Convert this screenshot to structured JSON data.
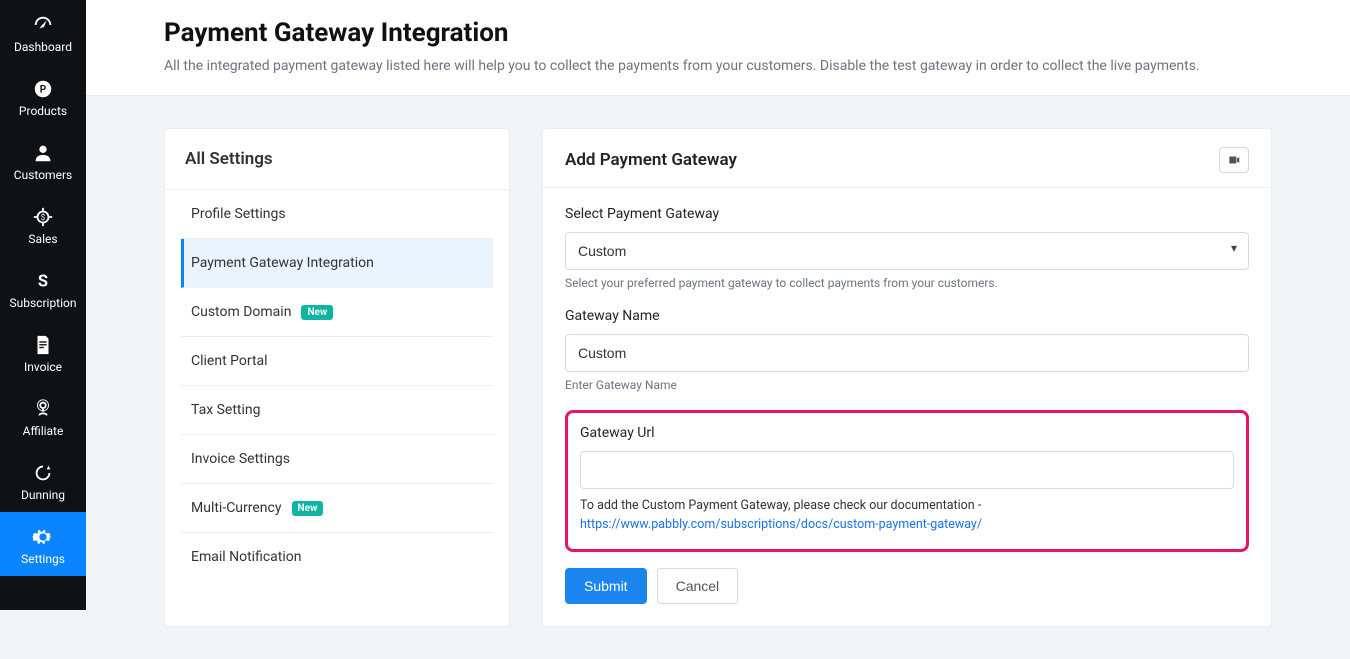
{
  "sidebar": {
    "items": [
      {
        "label": "Dashboard",
        "icon": "dashboard-icon"
      },
      {
        "label": "Products",
        "icon": "products-icon"
      },
      {
        "label": "Customers",
        "icon": "customers-icon"
      },
      {
        "label": "Sales",
        "icon": "sales-icon"
      },
      {
        "label": "Subscription",
        "icon": "subscription-icon"
      },
      {
        "label": "Invoice",
        "icon": "invoice-icon"
      },
      {
        "label": "Affiliate",
        "icon": "affiliate-icon"
      },
      {
        "label": "Dunning",
        "icon": "dunning-icon"
      },
      {
        "label": "Settings",
        "icon": "settings-icon"
      }
    ]
  },
  "header": {
    "title": "Payment Gateway Integration",
    "subtitle": "All the integrated payment gateway listed here will help you to collect the payments from your customers. Disable the test gateway in order to collect the live payments."
  },
  "settings_panel": {
    "title": "All Settings",
    "items": [
      {
        "label": "Profile Settings",
        "badge": null,
        "active": false
      },
      {
        "label": "Payment Gateway Integration",
        "badge": null,
        "active": true
      },
      {
        "label": "Custom Domain",
        "badge": "New",
        "active": false
      },
      {
        "label": "Client Portal",
        "badge": null,
        "active": false
      },
      {
        "label": "Tax Setting",
        "badge": null,
        "active": false
      },
      {
        "label": "Invoice Settings",
        "badge": null,
        "active": false
      },
      {
        "label": "Multi-Currency",
        "badge": "New",
        "active": false
      },
      {
        "label": "Email Notification",
        "badge": null,
        "active": false
      }
    ]
  },
  "form": {
    "title": "Add Payment Gateway",
    "select_label": "Select Payment Gateway",
    "select_value": "Custom",
    "select_helper": "Select your preferred payment gateway to collect payments from your customers.",
    "name_label": "Gateway Name",
    "name_value": "Custom",
    "name_helper": "Enter Gateway Name",
    "url_label": "Gateway Url",
    "url_value": "",
    "url_helper_prefix": "To add the Custom Payment Gateway, please check our documentation - ",
    "url_doc_link": "https://www.pabbly.com/subscriptions/docs/custom-payment-gateway/",
    "submit_label": "Submit",
    "cancel_label": "Cancel"
  }
}
